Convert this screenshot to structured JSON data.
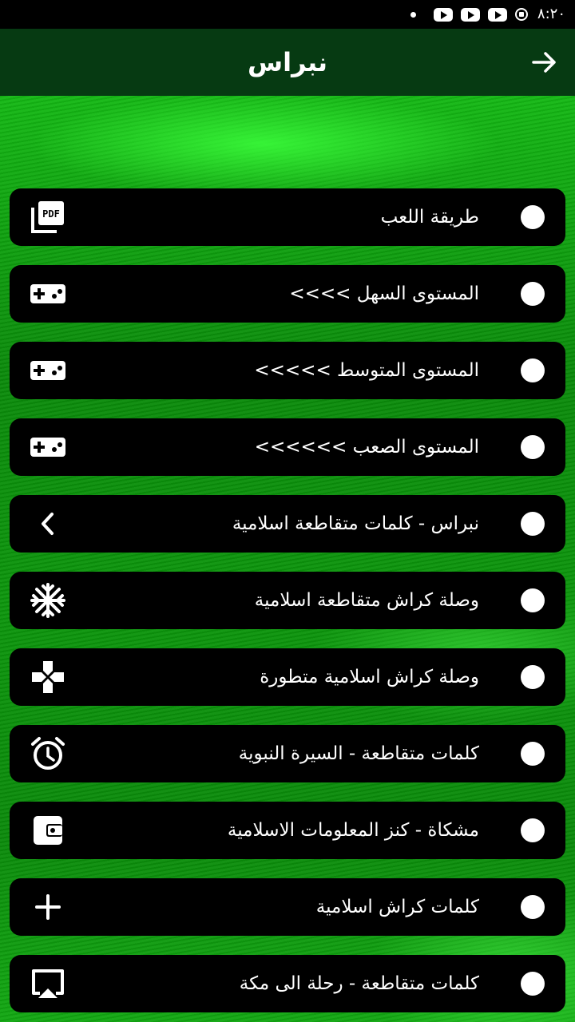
{
  "status_bar": {
    "time": "٨:٢٠"
  },
  "toolbar": {
    "title": "نبراس"
  },
  "menu": {
    "items": [
      {
        "label": "طريقة اللعب",
        "icon": "pdf-icon"
      },
      {
        "label": "المستوى السهل >>>>",
        "icon": "gamepad-icon"
      },
      {
        "label": "المستوى المتوسط >>>>>",
        "icon": "gamepad-icon"
      },
      {
        "label": "المستوى الصعب >>>>>>",
        "icon": "gamepad-icon"
      },
      {
        "label": "نبراس - كلمات متقاطعة اسلامية",
        "icon": "chevron-left-icon"
      },
      {
        "label": "وصلة كراش متقاطعة اسلامية",
        "icon": "snowflake-icon"
      },
      {
        "label": "وصلة كراش اسلامية متطورة",
        "icon": "dpad-icon"
      },
      {
        "label": "كلمات متقاطعة - السيرة النبوية",
        "icon": "alarm-icon"
      },
      {
        "label": "مشكاة - كنز المعلومات الاسلامية",
        "icon": "wallet-icon"
      },
      {
        "label": "كلمات كراش اسلامية",
        "icon": "plus-icon"
      },
      {
        "label": "كلمات متقاطعة - رحلة الى مكة",
        "icon": "airplay-icon"
      }
    ]
  },
  "colors": {
    "toolbar": "#063a12",
    "accent": "#0c8a0c",
    "item_bg": "#000000"
  }
}
